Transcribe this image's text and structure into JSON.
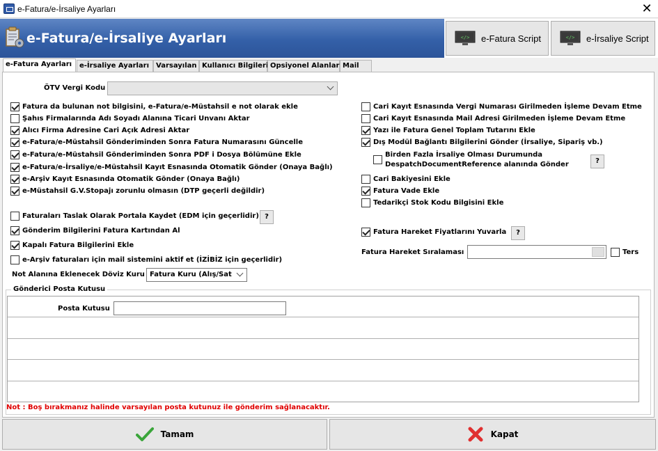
{
  "window": {
    "title": "e-Fatura/e-İrsaliye Ayarları"
  },
  "header": {
    "title": "e-Fatura/e-İrsaliye Ayarları",
    "efatura_script": "e-Fatura Script",
    "eirsaliye_script": "e-İrsaliye Script"
  },
  "tabs": [
    {
      "label": "e-Fatura Ayarları",
      "active": true
    },
    {
      "label": "e-İrsaliye Ayarları",
      "active": false
    },
    {
      "label": "Varsayılan",
      "active": false
    },
    {
      "label": "Kullanıcı Bilgileri",
      "active": false
    },
    {
      "label": "Opsiyonel Alanlar",
      "active": false
    },
    {
      "label": "Mail",
      "active": false
    }
  ],
  "otv": {
    "label": "ÖTV Vergi Kodu",
    "value": ""
  },
  "left_checks": [
    {
      "label": "Fatura da bulunan not bilgisini, e-Fatura/e-Müstahsil e not olarak ekle",
      "checked": true
    },
    {
      "label": "Şahıs Firmalarında Adı Soyadı Alanına Ticari Unvanı Aktar",
      "checked": false
    },
    {
      "label": "Alıcı Firma Adresine Cari Açık Adresi Aktar",
      "checked": true
    },
    {
      "label": "e-Fatura/e-Müstahsil Gönderiminden Sonra Fatura Numarasını Güncelle",
      "checked": true
    },
    {
      "label": "e-Fatura/e-Müstahsil Gönderiminden Sonra PDF i Dosya Bölümüne Ekle",
      "checked": true
    },
    {
      "label": "e-Fatura/e-İrsaliye/e-Müstahsil Kayıt Esnasında Otomatik Gönder (Onaya Bağlı)",
      "checked": true
    },
    {
      "label": "e-Arşiv Kayıt Esnasında Otomatik Gönder (Onaya Bağlı)",
      "checked": true
    },
    {
      "label": "e-Müstahsil G.V.Stopajı zorunlu olmasın (DTP geçerli değildir)",
      "checked": true
    }
  ],
  "left_checks2": [
    {
      "label": "Faturaları Taslak Olarak Portala Kaydet (EDM için geçerlidir)",
      "checked": false
    },
    {
      "label": "Gönderim Bilgilerini Fatura Kartından Al",
      "checked": true
    },
    {
      "label": "Kapalı Fatura Bilgilerini Ekle",
      "checked": true
    },
    {
      "label": "e-Arşiv faturaları için mail sistemini aktif et (İZİBİZ için geçerlidir)",
      "checked": false
    }
  ],
  "doviz": {
    "label": "Not Alanına Eklenecek Döviz Kuru",
    "value": "Fatura Kuru (Alış/Sat"
  },
  "right_checks": [
    {
      "label": "Cari Kayıt Esnasında Vergi Numarası Girilmeden İşleme Devam Etme",
      "checked": false
    },
    {
      "label": "Cari Kayıt Esnasında Mail Adresi Girilmeden İşleme Devam Etme",
      "checked": false
    },
    {
      "label": "Yazı ile Fatura Genel Toplam Tutarını Ekle",
      "checked": true
    },
    {
      "label": "Dış Modül Bağlantı Bilgilerini Gönder (İrsaliye, Sipariş vb.)",
      "checked": true
    }
  ],
  "despatch": {
    "line1": "Birden Fazla İrsaliye Olması Durumunda",
    "line2": "DespatchDocumentReference alanında Gönder",
    "checked": false
  },
  "right_checks2": [
    {
      "label": "Cari Bakiyesini Ekle",
      "checked": false
    },
    {
      "label": "Fatura Vade Ekle",
      "checked": true
    },
    {
      "label": "Tedarikçi Stok Kodu Bilgisini Ekle",
      "checked": false
    }
  ],
  "yuvarla": {
    "label": "Fatura Hareket Fiyatlarını Yuvarla",
    "checked": true
  },
  "siralama": {
    "label": "Fatura Hareket Sıralaması",
    "value": "",
    "ters_label": "Ters",
    "ters_checked": false
  },
  "help_label": "?",
  "posta": {
    "group_title": "Gönderici Posta Kutusu",
    "label": "Posta Kutusu",
    "value": ""
  },
  "note": "Not : Boş bırakmanız halinde varsayılan posta kutunuz ile gönderim sağlanacaktır.",
  "buttons": {
    "ok": "Tamam",
    "close": "Kapat"
  },
  "colors": {
    "banner": "#3460a8",
    "note": "#e00000",
    "ok_check": "#3aa53a",
    "close_x": "#e03030"
  }
}
